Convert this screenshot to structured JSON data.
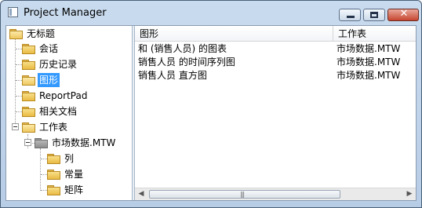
{
  "window": {
    "title": "Project Manager",
    "minimize_glyph": "",
    "maximize_glyph": "",
    "close_glyph": "✕"
  },
  "tree": {
    "root": "无标题",
    "items": [
      {
        "label": "会话"
      },
      {
        "label": "历史记录"
      },
      {
        "label": "图形",
        "selected": true
      },
      {
        "label": "ReportPad"
      },
      {
        "label": "相关文档"
      },
      {
        "label": "工作表"
      },
      {
        "label": "市场数据.MTW"
      },
      {
        "label": "列"
      },
      {
        "label": "常量"
      },
      {
        "label": "矩阵"
      }
    ]
  },
  "list": {
    "columns": [
      "图形",
      "工作表"
    ],
    "rows": [
      {
        "graph": "和 (销售人员) 的图表",
        "worksheet": "市场数据.MTW"
      },
      {
        "graph": "销售人员 的时间序列图",
        "worksheet": "市场数据.MTW"
      },
      {
        "graph": "销售人员 直方图",
        "worksheet": "市场数据.MTW"
      }
    ]
  },
  "scrollbar": {
    "left_arrow": "◀",
    "right_arrow": "▶",
    "grip": "|||"
  },
  "colors": {
    "selection": "#3399ff",
    "folder": "#e9bb43",
    "title_bar": "#c9dbee"
  }
}
